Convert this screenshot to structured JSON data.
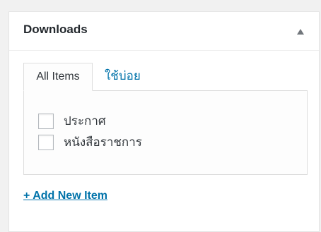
{
  "metabox": {
    "title": "Downloads",
    "toggle_icon": "triangle-up-icon"
  },
  "tabs": [
    {
      "label": "All Items",
      "active": true
    },
    {
      "label": "ใช้บ่อย",
      "active": false
    }
  ],
  "terms": [
    {
      "label": "ประกาศ",
      "checked": false
    },
    {
      "label": "หนังสือราชการ",
      "checked": false
    }
  ],
  "add_new": {
    "label": "+ Add New Item"
  },
  "colors": {
    "link": "#0073aa",
    "text": "#23282d",
    "border": "#dddddd",
    "background": "#f1f1f1"
  }
}
